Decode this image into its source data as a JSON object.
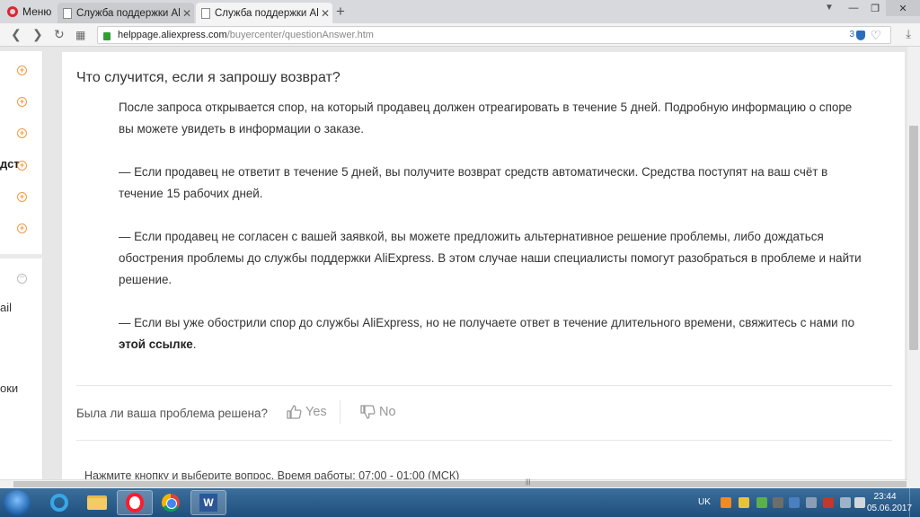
{
  "browser": {
    "menu_label": "Меню",
    "tabs": [
      {
        "label": "Служба поддержки AliExpress"
      },
      {
        "label": "Служба поддержки AliExpress"
      }
    ],
    "new_tab": "+",
    "window_controls": {
      "minimize": "—",
      "maximize": "❐",
      "close": "✕"
    },
    "url_host": "helppage.aliexpress.com",
    "url_path": "/buyercenter/questionAnswer.htm",
    "shield_count": "3"
  },
  "sidebar": {
    "bold_fragment": "дст",
    "text_fragment_1": "ail",
    "text_fragment_2": "оки"
  },
  "article": {
    "question": "Что случится, если я запрошу возврат?",
    "paragraphs": [
      "После запроса открывается спор, на который продавец должен отреагировать в течение 5 дней. Подробную информацию о споре вы можете увидеть в информации о заказе.",
      "— Если продавец не ответит в течение 5 дней, вы получите возврат средств автоматически. Средства поступят на ваш счёт в течение 15 рабочих дней.",
      "— Если продавец не согласен с вашей заявкой, вы можете предложить альтернативное решение проблемы, либо дождаться обострения проблемы до службы поддержки AliExpress. В этом случае наши специалисты помогут разобраться в проблеме и найти решение."
    ],
    "last_paragraph_pre": "— Если вы уже обострили спор до службы AliExpress, но не получаете ответ в течение длительного времени, свяжитесь с нами по ",
    "last_paragraph_link": "этой ссылке",
    "last_paragraph_post": "."
  },
  "feedback": {
    "question": "Была ли ваша проблема решена?",
    "yes_label": "Yes",
    "no_label": "No"
  },
  "bottom_note": "Нажмите кнопку и выберите вопрос. Время работы: 07:00 - 01:00 (МСК)",
  "taskbar": {
    "language": "UK",
    "time": "23:44",
    "date": "05.06.2017"
  }
}
